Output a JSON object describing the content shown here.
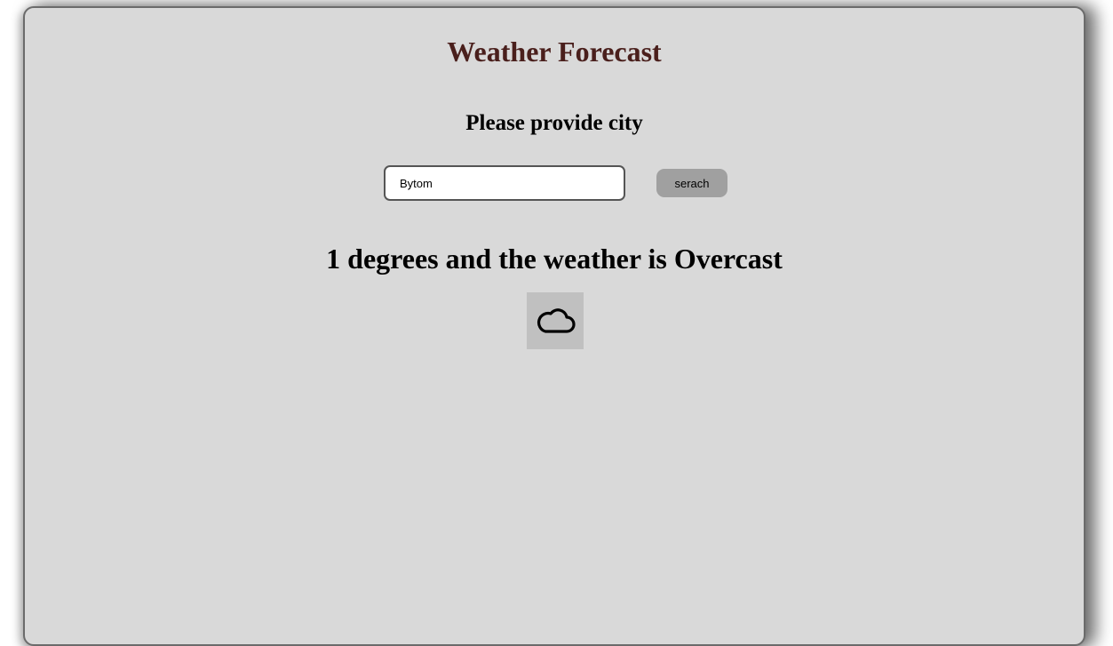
{
  "header": {
    "title": "Weather Forecast",
    "title_color": "#4a1f1c"
  },
  "prompt": {
    "text": "Please provide city"
  },
  "search": {
    "value": "Bytom",
    "button_label": "serach"
  },
  "result": {
    "text": "1 degrees and the weather is Overcast",
    "icon": "cloud-icon"
  },
  "colors": {
    "panel_background": "#d9d9d9",
    "button_background": "#a0a0a0",
    "icon_background": "#c0c0c0"
  }
}
